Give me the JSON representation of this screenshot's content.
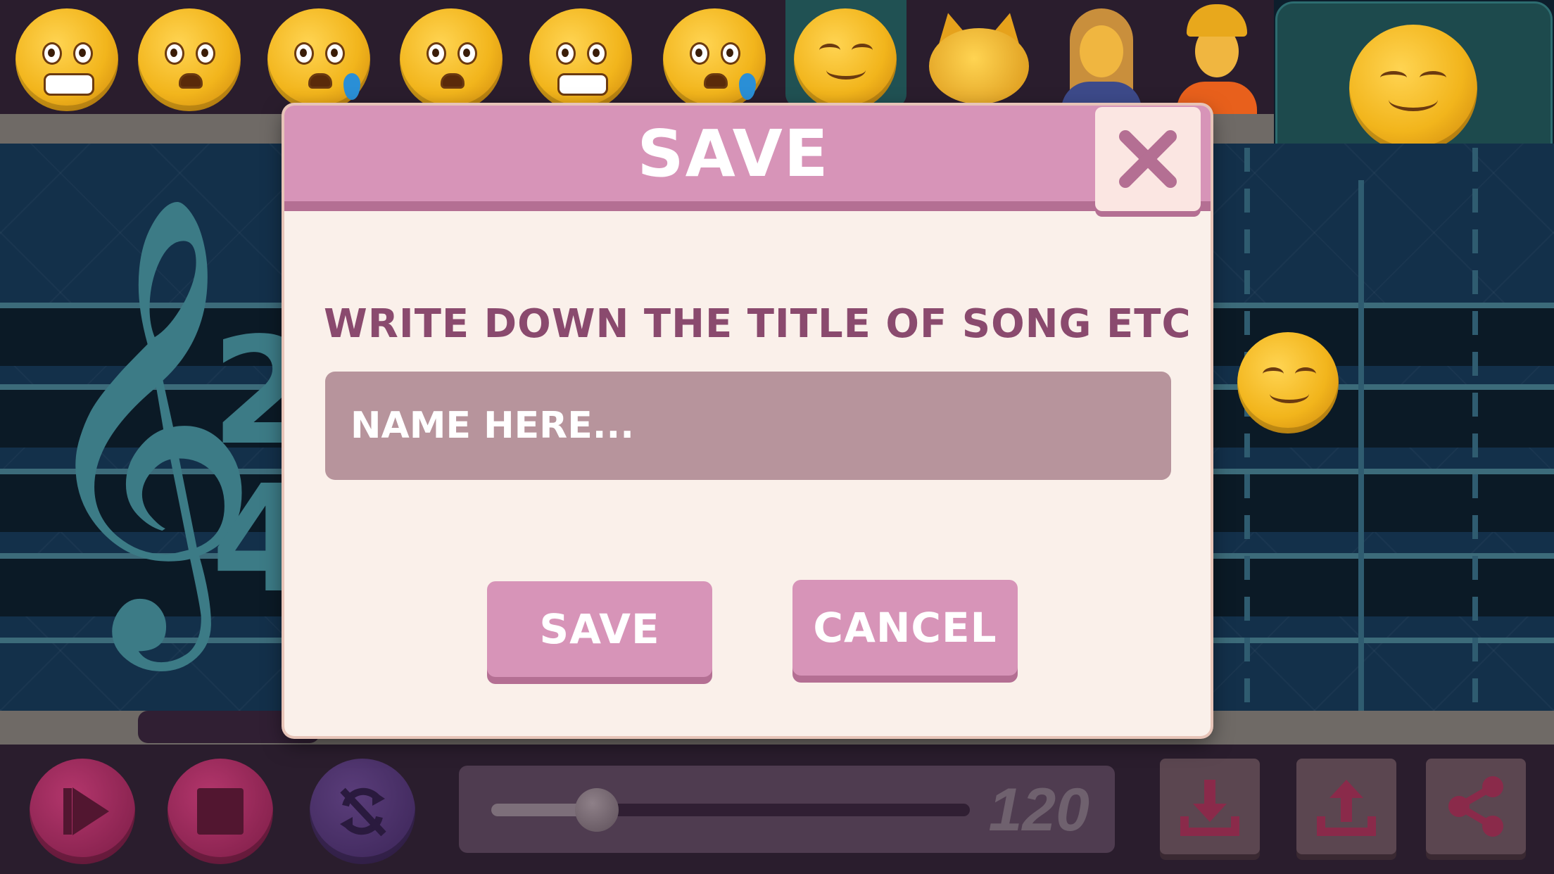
{
  "dialog": {
    "title": "SAVE",
    "prompt": "WRITE DOWN THE TITLE OF SONG ETC",
    "name_input": {
      "placeholder": "NAME HERE...",
      "value": ""
    },
    "save_label": "SAVE",
    "cancel_label": "CANCEL",
    "close_icon": "close-icon"
  },
  "staff": {
    "clef": "𝄞",
    "time_signature": {
      "top": "2",
      "bottom": "4"
    }
  },
  "palette": {
    "items": [
      "grimacing-face",
      "hushed-face",
      "sad-sweat-face",
      "frowning-face",
      "grimacing-face",
      "sad-sweat-face",
      "relieved-face",
      "cat-face",
      "face-palm-woman",
      "construction-worker"
    ],
    "selected_index": 6
  },
  "toolbar": {
    "tempo": {
      "value": "120",
      "slider_fraction": 0.22
    },
    "buttons": [
      "play-icon",
      "stop-icon",
      "loop-off-icon",
      "download-icon",
      "upload-icon",
      "share-icon"
    ]
  },
  "colors": {
    "dialog_accent": "#d794b8",
    "dialog_text": "#8a4a6e",
    "dialog_background": "#faf0ea",
    "staff_background": "#13304a"
  }
}
